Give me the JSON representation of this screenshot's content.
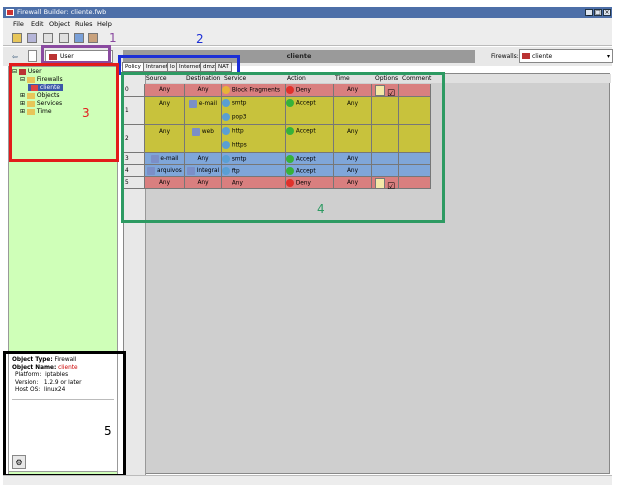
{
  "window": {
    "title": "Firewall Builder: cliente.fwb"
  },
  "menu": [
    "File",
    "Edit",
    "Object",
    "Rules",
    "Help"
  ],
  "objectbar": {
    "selected": "User",
    "center_title": "cliente",
    "firewalls_label": "Firewalls:",
    "firewalls_value": "cliente"
  },
  "tree": {
    "root": "User",
    "items": [
      "Firewalls",
      "cliente",
      "Objects",
      "Services",
      "Time"
    ]
  },
  "tabs": [
    "Policy",
    "Intranet",
    "lo",
    "Internet",
    "dmz",
    "NAT"
  ],
  "columns": [
    "Source",
    "Destination",
    "Service",
    "Action",
    "Time",
    "Options",
    "Comment"
  ],
  "rules": [
    {
      "num": "0",
      "source": "Any",
      "destination": "Any",
      "service": [
        "Block Fragments"
      ],
      "action": "Deny",
      "time": "Any",
      "color": "#d97f7f"
    },
    {
      "num": "1",
      "source": "Any",
      "destination": "e-mail",
      "service": [
        "smtp",
        "pop3"
      ],
      "action": "Accept",
      "time": "Any",
      "color": "#c8c23c"
    },
    {
      "num": "2",
      "source": "Any",
      "destination": "web",
      "service": [
        "http",
        "https"
      ],
      "action": "Accept",
      "time": "Any",
      "color": "#c8c23c"
    },
    {
      "num": "3",
      "source": "e-mail",
      "destination": "Any",
      "service": [
        "smtp"
      ],
      "action": "Accept",
      "time": "Any",
      "color": "#7fa6d9"
    },
    {
      "num": "4",
      "source": "arquivos",
      "destination": "Integral",
      "service": [
        "ftp"
      ],
      "action": "Accept",
      "time": "Any",
      "color": "#7fa6d9"
    },
    {
      "num": "5",
      "source": "Any",
      "destination": "Any",
      "service": [
        "Any"
      ],
      "action": "Deny",
      "time": "Any",
      "color": "#d97f7f"
    }
  ],
  "info": {
    "type_label": "Object Type:",
    "type_value": "Firewall",
    "name_label": "Object Name:",
    "name_value": "cliente",
    "platform_label": "Platform:",
    "platform_value": "iptables",
    "version_label": "Version:",
    "version_value": "1.2.9 or later",
    "hostos_label": "Host OS:",
    "hostos_value": "linux24"
  },
  "callouts": [
    "1",
    "2",
    "3",
    "4",
    "5"
  ],
  "colors": {
    "deny": "#d97f7f",
    "accept": "#c8c23c",
    "blue": "#7fa6d9",
    "tree_bg": "#cfffb8"
  }
}
